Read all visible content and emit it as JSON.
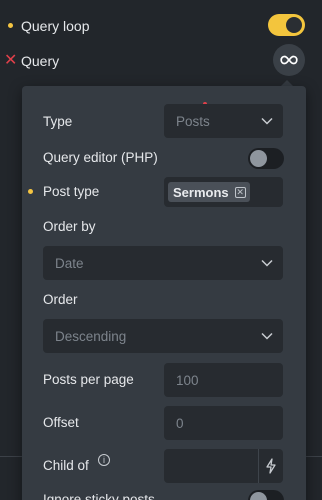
{
  "top": {
    "query_loop": {
      "label": "Query loop",
      "enabled": true
    },
    "query": {
      "label": "Query"
    }
  },
  "query_panel": {
    "type": {
      "label": "Type",
      "value": "Posts"
    },
    "query_editor": {
      "label": "Query editor (PHP)",
      "enabled": false
    },
    "post_type": {
      "label": "Post type",
      "tags": [
        "Sermons"
      ]
    },
    "order_by": {
      "label": "Order by",
      "placeholder": "Date"
    },
    "order": {
      "label": "Order",
      "placeholder": "Descending"
    },
    "posts_per_page": {
      "label": "Posts per page",
      "placeholder": "100"
    },
    "offset": {
      "label": "Offset",
      "placeholder": "0"
    },
    "child_of": {
      "label": "Child of",
      "value": ""
    },
    "ignore_sticky": {
      "label": "Ignore sticky posts",
      "enabled": false
    }
  },
  "colors": {
    "background": "#22262b",
    "panel": "#353b42",
    "field": "#272b30",
    "accent": "#f3c53d",
    "error": "#e0404a"
  }
}
